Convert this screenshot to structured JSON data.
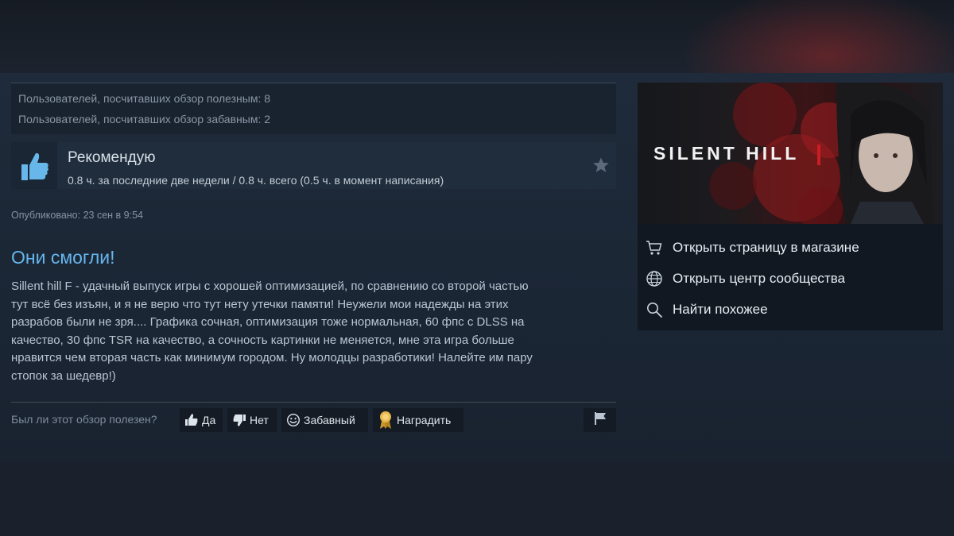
{
  "stats": {
    "helpful": "Пользователей, посчитавших обзор полезным: 8",
    "funny": "Пользователей, посчитавших обзор забавным: 2"
  },
  "verdict": {
    "title": "Рекомендую",
    "hours": "0.8 ч. за последние две недели / 0.8 ч. всего (0.5 ч. в момент написания)"
  },
  "posted": "Опубликовано: 23 сен в 9:54",
  "review": {
    "title": "Они смогли!",
    "lines": [
      "Sillent hill F - удачный выпуск игры с хорошей оптимизацией, по сравнению со второй частью",
      "тут всё без изъян, и я не верю что тут нету утечки памяти! Неужели мои надежды на этих",
      "разрабов были не зря.... Графика сочная, оптимизация тоже нормальная, 60 фпс с DLSS на",
      "качество, 30 фпс TSR на качество, а сочность картинки не меняется, мне эта игра больше",
      "нравится чем вторая часть как минимум городом. Ну молодцы разработики! Налейте им пару",
      "стопок за шедевр!)"
    ]
  },
  "rating": {
    "question": "Был ли этот обзор полезен?",
    "yes": "Да",
    "no": "Нет",
    "funny": "Забавный",
    "award": "Наградить"
  },
  "game": {
    "logo_text": "SILENT HILL"
  },
  "side_links": {
    "store": "Открыть страницу в магазине",
    "community": "Открыть центр сообщества",
    "similar": "Найти похожее"
  },
  "icons": {
    "verdict": "thumbs-up-icon",
    "favorite": "star-icon",
    "yes": "thumbs-up-icon",
    "no": "thumbs-down-icon",
    "funny": "smiley-icon",
    "award": "award-medal-icon",
    "report": "flag-icon",
    "store": "cart-icon",
    "community": "globe-icon",
    "similar": "search-icon"
  },
  "colors": {
    "accent_title": "#66b6ee",
    "thumb_blue": "#67b7ea",
    "award_gold": "#e8b84a"
  }
}
